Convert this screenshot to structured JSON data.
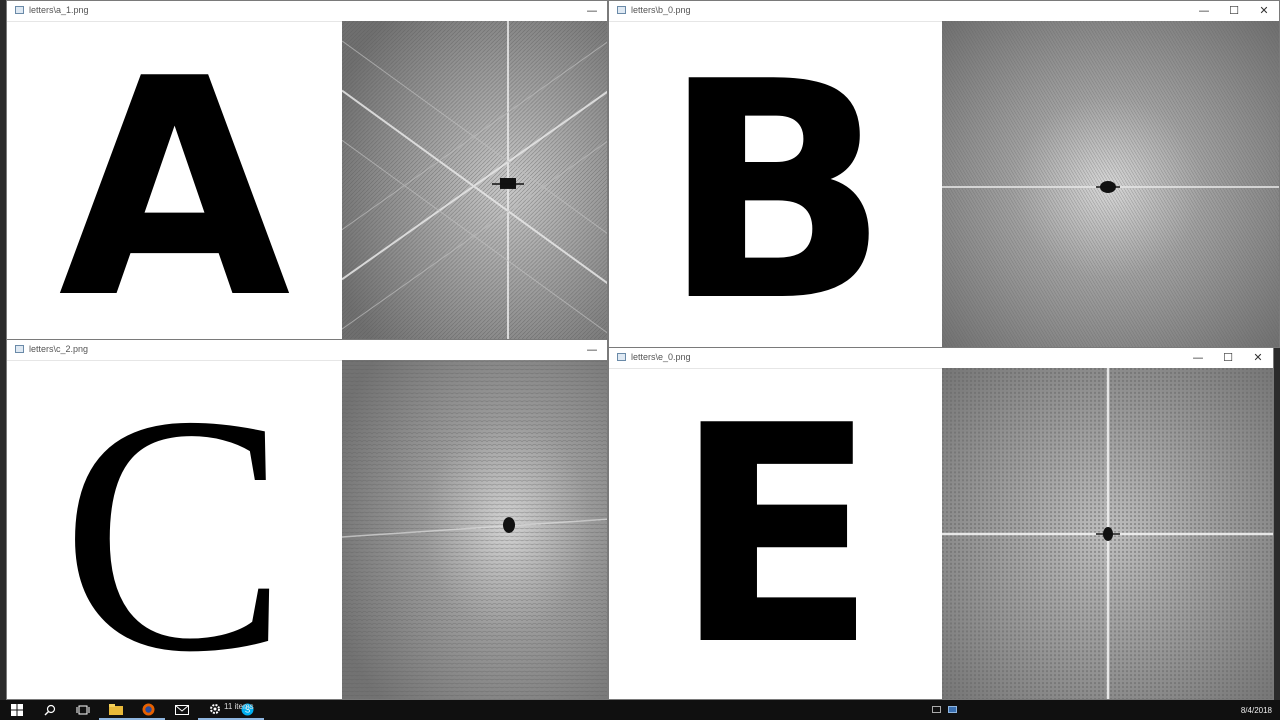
{
  "windows": [
    {
      "id": "a",
      "title": "letters\\a_1.png",
      "letter": "A"
    },
    {
      "id": "b",
      "title": "letters\\b_0.png",
      "letter": "B"
    },
    {
      "id": "c",
      "title": "letters\\c_2.png",
      "letter": "C"
    },
    {
      "id": "e",
      "title": "letters\\e_0.png",
      "letter": "E"
    }
  ],
  "controls": {
    "minimize": "—",
    "maximize": "☐",
    "close": "✕"
  },
  "taskbar": {
    "status": "11 items",
    "date": "8/4/2018",
    "icons": [
      "windows-start-icon",
      "search-icon",
      "task-view-icon",
      "file-explorer-icon",
      "firefox-icon",
      "mail-icon",
      "settings-icon",
      "skype-icon"
    ]
  },
  "colors": {
    "taskbar": "#101010",
    "fft_gray": "#777777",
    "accent": "#8fb6e0"
  }
}
